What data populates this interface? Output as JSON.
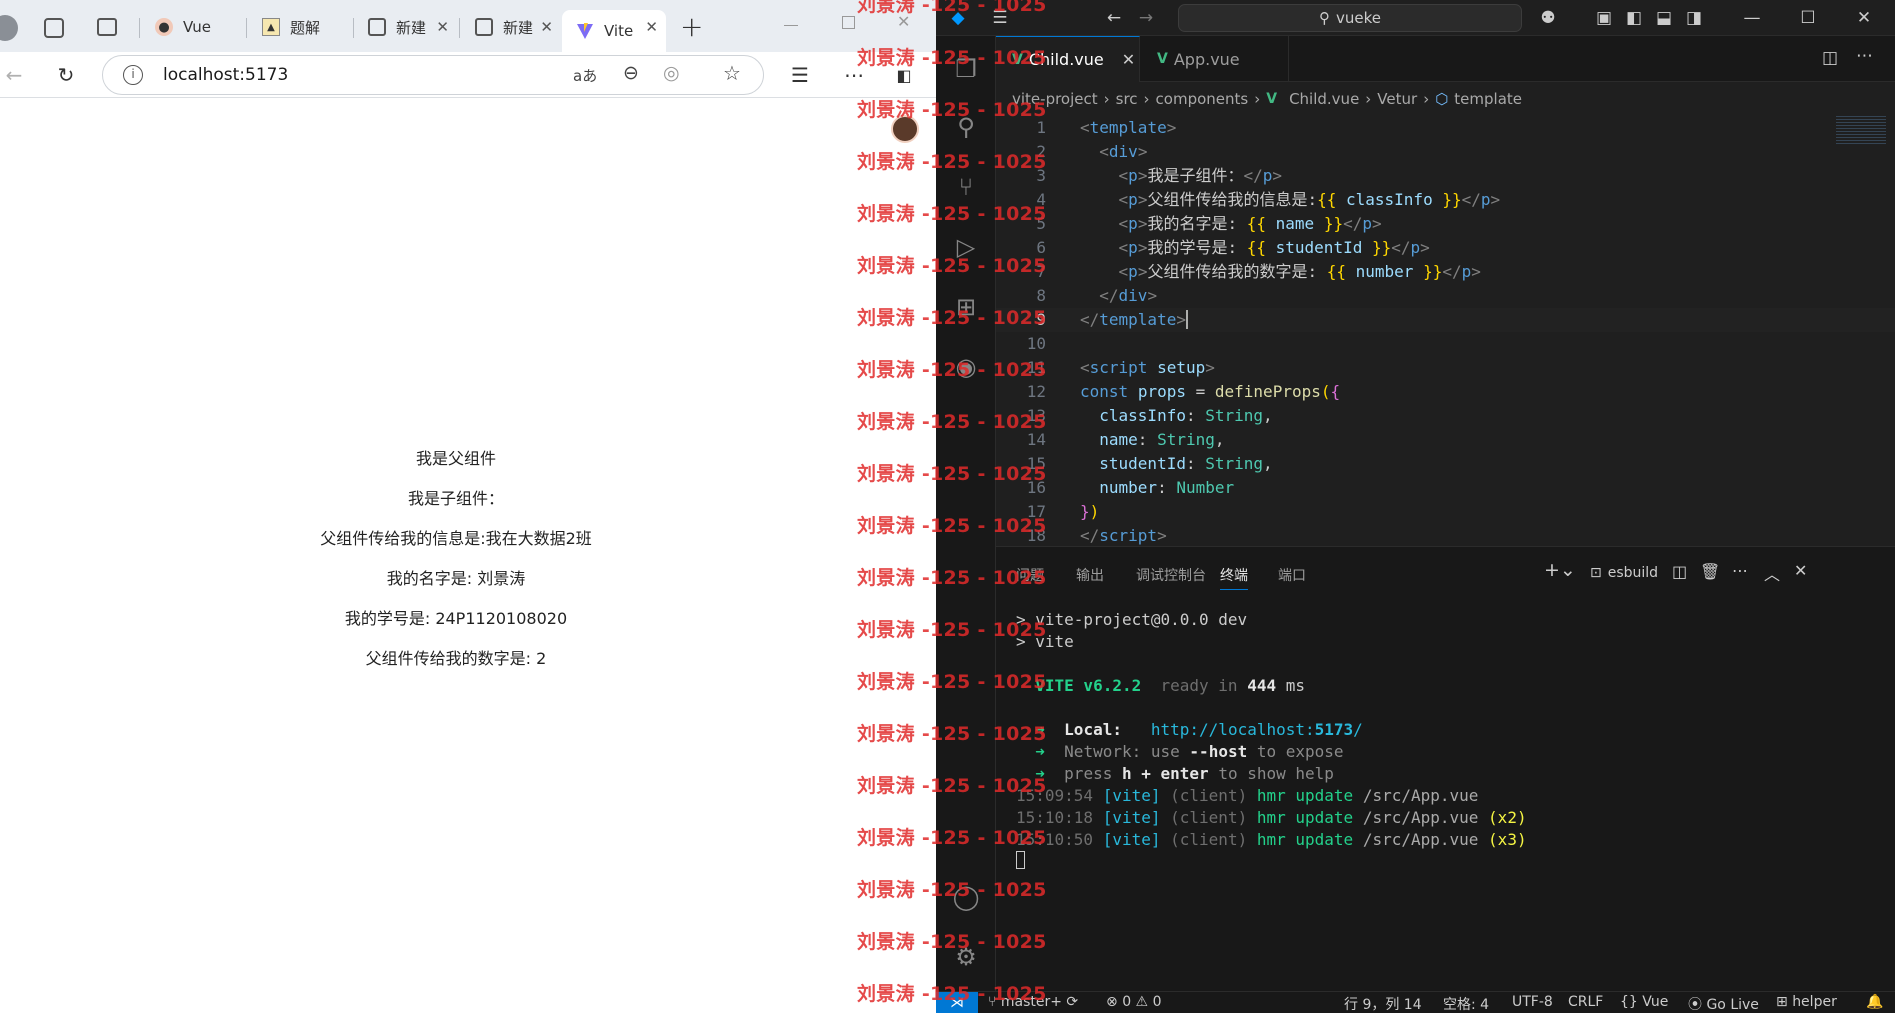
{
  "browser": {
    "tabs": [
      {
        "label": "",
        "icon": "avatar-icon"
      },
      {
        "label": "",
        "icon": "collections-icon"
      },
      {
        "label": "",
        "icon": "tab-actions-icon"
      },
      {
        "label": "Vue",
        "icon": "profile-favicon"
      },
      {
        "label": "题解",
        "icon": "image-favicon"
      },
      {
        "label": "新建",
        "icon": "page-favicon"
      },
      {
        "label": "新建",
        "icon": "page-favicon"
      },
      {
        "label": "Vite",
        "icon": "vite-favicon"
      }
    ],
    "new_tab": "+",
    "url": "localhost:5173",
    "page_lines": [
      "我是父组件",
      "我是子组件：",
      "父组件传给我的信息是:我在大数据2班",
      "我的名字是: 刘景涛",
      "我的学号是: 24P1120108020",
      "父组件传给我的数字是: 2"
    ]
  },
  "watermark": "刘景涛 -125 - 1025",
  "vscode": {
    "search": "vueke",
    "tabs": [
      "Child.vue",
      "App.vue"
    ],
    "breadcrumb": [
      "vite-project",
      "src",
      "components",
      "Child.vue",
      "Vetur",
      "template"
    ],
    "panel_tabs": [
      "问题",
      "输出",
      "调试控制台",
      "终端",
      "端口"
    ],
    "terminal_name": "esbuild",
    "terminal": {
      "l1": "> vite-project@0.0.0 dev",
      "l2": "> vite",
      "vite_label": "VITE v6.2.2",
      "ready": "ready in",
      "ms_value": "444",
      "ms_unit": "ms",
      "local_label": "Local:",
      "local_url": "http://localhost:",
      "local_port": "5173",
      "network_label": "Network:",
      "network_text": "use",
      "network_flag": "--host",
      "network_end": "to expose",
      "press": "press",
      "press_key": "h + enter",
      "press_end": "to show help",
      "logs": [
        {
          "time": "15:09:54",
          "tag": "[vite]",
          "client": "(client)",
          "msg": "hmr update",
          "path": "/src/App.vue",
          "count": ""
        },
        {
          "time": "15:10:18",
          "tag": "[vite]",
          "client": "(client)",
          "msg": "hmr update",
          "path": "/src/App.vue",
          "count": "(x2)"
        },
        {
          "time": "15:10:50",
          "tag": "[vite]",
          "client": "(client)",
          "msg": "hmr update",
          "path": "/src/App.vue",
          "count": "(x3)"
        }
      ]
    },
    "status": {
      "branch": "master+",
      "errors": "0",
      "warnings": "0",
      "position": "行 9，列 14",
      "spaces": "空格: 4",
      "encoding": "UTF-8",
      "eol": "CRLF",
      "language": "Vue",
      "golive": "Go Live",
      "helper": "helper"
    }
  }
}
